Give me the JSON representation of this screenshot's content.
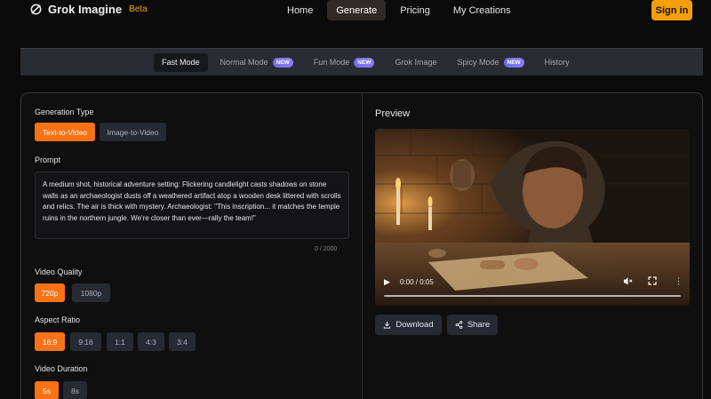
{
  "header": {
    "brand_name": "Grok Imagine",
    "brand_badge": "Beta",
    "nav": [
      {
        "label": "Home",
        "active": false
      },
      {
        "label": "Generate",
        "active": true
      },
      {
        "label": "Pricing",
        "active": false
      },
      {
        "label": "My Creations",
        "active": false
      }
    ],
    "signin_label": "Sign in"
  },
  "modes": [
    {
      "label": "Fast Mode",
      "active": true,
      "badge": ""
    },
    {
      "label": "Normal Mode",
      "active": false,
      "badge": "NEW"
    },
    {
      "label": "Fun Mode",
      "active": false,
      "badge": "NEW"
    },
    {
      "label": "Grok Image",
      "active": false,
      "badge": ""
    },
    {
      "label": "Spicy Mode",
      "active": false,
      "badge": "NEW"
    },
    {
      "label": "History",
      "active": false,
      "badge": ""
    }
  ],
  "form": {
    "generation_type_label": "Generation Type",
    "generation_types": [
      "Text-to-Video",
      "Image-to-Video"
    ],
    "generation_type_selected": "Text-to-Video",
    "prompt_label": "Prompt",
    "prompt_value": "A medium shot, historical adventure setting: Flickering candlelight casts shadows on stone walls as an archaeologist dusts off a weathered artifact atop a wooden desk littered with scrolls and relics. The air is thick with mystery. Archaeologist: \"This inscription... it matches the temple ruins in the northern jungle. We're closer than ever—rally the team!\"",
    "prompt_counter": "0 / 2000",
    "quality_label": "Video Quality",
    "qualities": [
      "720p",
      "1080p"
    ],
    "quality_selected": "720p",
    "aspect_label": "Aspect Ratio",
    "aspects": [
      "16:9",
      "9:16",
      "1:1",
      "4:3",
      "3:4"
    ],
    "aspect_selected": "16:9",
    "duration_label": "Video Duration",
    "durations": [
      "5s",
      "8s"
    ],
    "duration_selected": "5s"
  },
  "preview": {
    "title": "Preview",
    "time": "0:00 / 0:05",
    "progress": 0,
    "download_label": "Download",
    "share_label": "Share"
  },
  "colors": {
    "accent": "#f97316",
    "brand": "#f59e0b",
    "badge_new": "#7c6cf2"
  }
}
